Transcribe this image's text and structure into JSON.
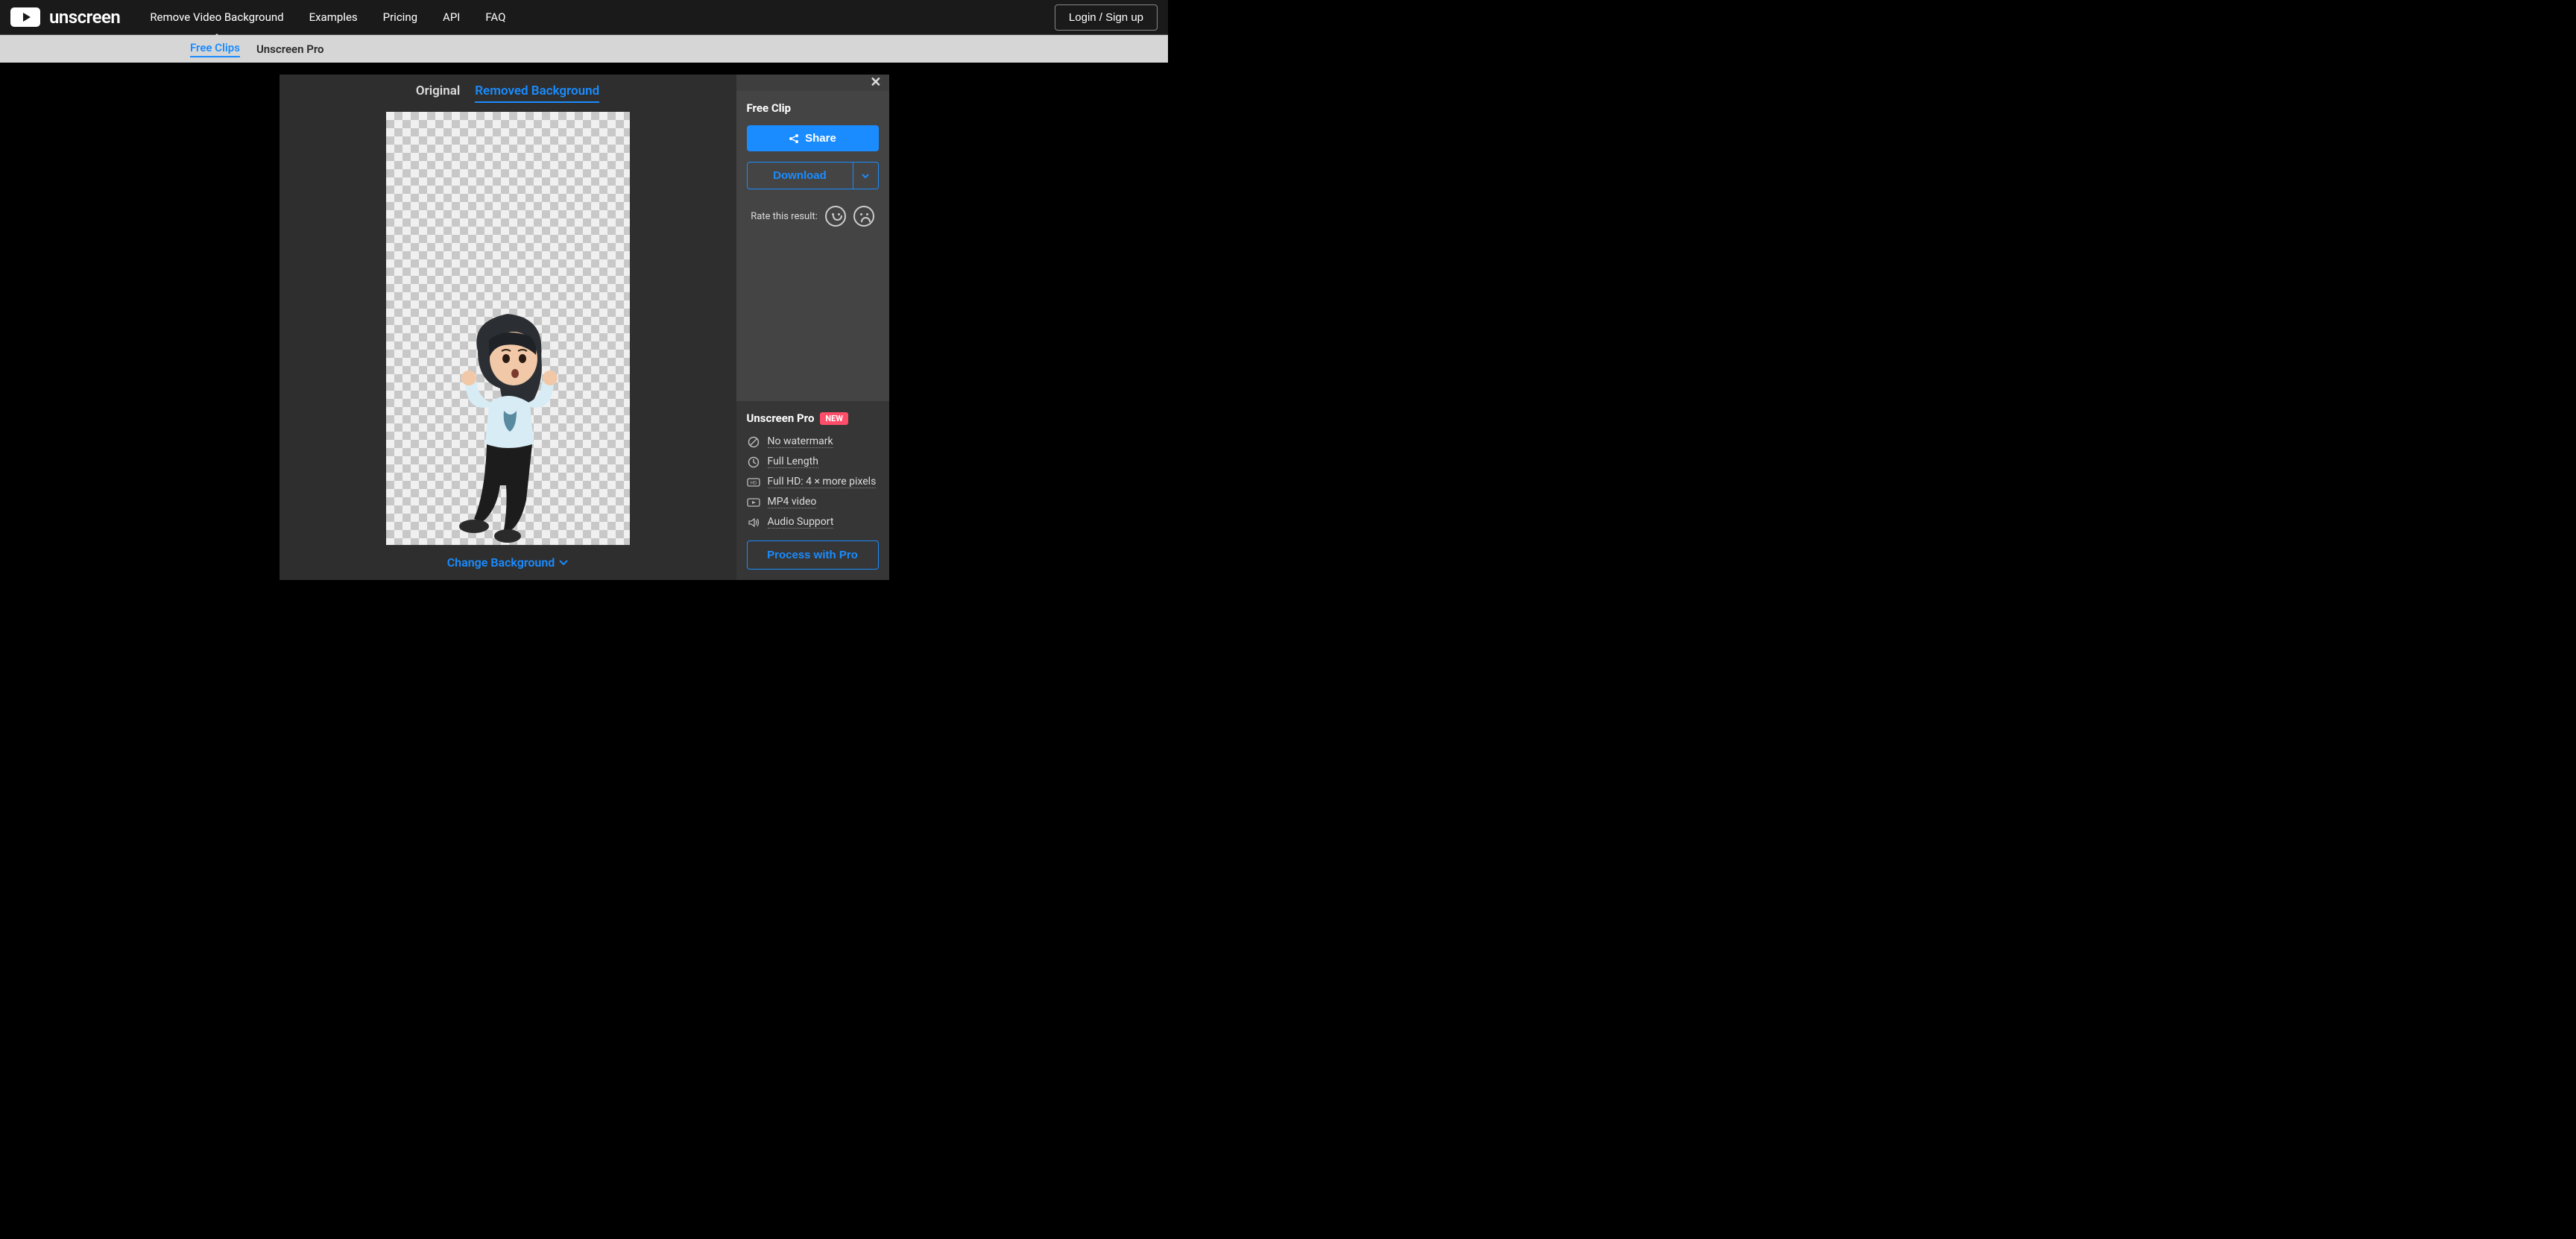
{
  "brand": "unscreen",
  "nav": {
    "removeBg": "Remove Video Background",
    "examples": "Examples",
    "pricing": "Pricing",
    "api": "API",
    "faq": "FAQ",
    "login": "Login / Sign up"
  },
  "subnav": {
    "freeClips": "Free Clips",
    "pro": "Unscreen Pro"
  },
  "viewTabs": {
    "original": "Original",
    "removed": "Removed Background"
  },
  "changeBg": "Change Background",
  "sidebar": {
    "freeClipTitle": "Free Clip",
    "share": "Share",
    "download": "Download",
    "rateLabel": "Rate this result:"
  },
  "proSection": {
    "title": "Unscreen Pro",
    "badge": "NEW",
    "features": [
      "No watermark",
      "Full Length",
      "Full HD: 4 × more pixels",
      "MP4 video",
      "Audio Support"
    ],
    "cta": "Process with Pro"
  }
}
